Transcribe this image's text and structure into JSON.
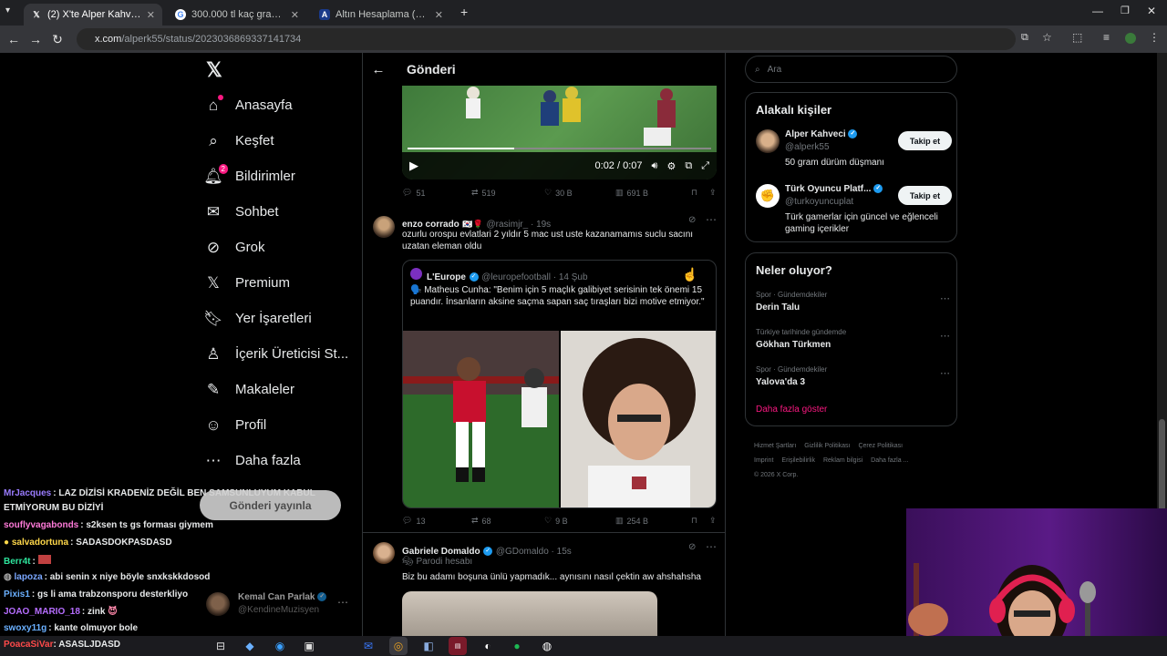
{
  "browser": {
    "tabs": [
      {
        "title": "(2) X'te Alper Kahveci: \"TL İLE N",
        "icon": "x-logo-icon"
      },
      {
        "title": "300.000 tl kaç gram altın - Goo",
        "icon": "google-icon"
      },
      {
        "title": "Altın Hesaplama (Çeyrek ve Gra",
        "icon": "site-icon"
      }
    ],
    "url_host": "x.com",
    "url_path": "/alperk55/status/2023036869337141734"
  },
  "nav": {
    "items": [
      {
        "label": "Anasayfa",
        "icon": "home-icon"
      },
      {
        "label": "Keşfet",
        "icon": "search-icon"
      },
      {
        "label": "Bildirimler",
        "icon": "bell-icon",
        "badge": "2"
      },
      {
        "label": "Sohbet",
        "icon": "mail-icon"
      },
      {
        "label": "Grok",
        "icon": "grok-icon"
      },
      {
        "label": "Premium",
        "icon": "x-icon"
      },
      {
        "label": "Yer İşaretleri",
        "icon": "bookmark-icon"
      },
      {
        "label": "İçerik Üreticisi St...",
        "icon": "creator-icon"
      },
      {
        "label": "Makaleler",
        "icon": "article-icon"
      },
      {
        "label": "Profil",
        "icon": "person-icon"
      },
      {
        "label": "Daha fazla",
        "icon": "more-icon"
      }
    ],
    "post_button": "Gönderi yayınla"
  },
  "main": {
    "header": "Gönderi",
    "video": {
      "time": "0:02 / 0:07"
    },
    "post_stats": {
      "replies": "51",
      "reposts": "519",
      "likes": "30 B",
      "views": "691 B"
    },
    "reply1": {
      "name": "enzo corrado",
      "handle": "@rasimjr_ · 19s",
      "text": "ozurlu orospu evlatlari 2 yıldır 5 mac ust uste kazanamamıs suclu sacını uzatan eleman oldu",
      "quote": {
        "name": "L'Europe",
        "handle": "@leuropefootball · 14 Şub",
        "text": "🗣️ Matheus Cunha: \"Benim için 5 maçlık galibiyet serisinin tek önemi 15 puandır. İnsanların aksine saçma sapan saç tıraşları bizi motive etmiyor.\""
      },
      "stats": {
        "replies": "13",
        "reposts": "68",
        "likes": "9 B",
        "views": "254 B"
      }
    },
    "reply2": {
      "name": "Gabriele Domaldo",
      "handle": "@GDomaldo · 15s",
      "label": "Parodi hesabı",
      "text": "Biz bu adamı boşuna ünlü yapmadık... aynısını nasıl çektin aw ahshahsha"
    }
  },
  "right": {
    "search_placeholder": "Ara",
    "related": {
      "title": "Alakalı kişiler",
      "people": [
        {
          "name": "Alper Kahveci",
          "handle": "@alperk55",
          "bio": "50 gram dürüm düşmanı",
          "follow": "Takip et"
        },
        {
          "name": "Türk Oyuncu Platf...",
          "handle": "@turkoyuncuplat",
          "bio": "Türk gamerlar için güncel ve eğlenceli gaming içerikler",
          "follow": "Takip et"
        }
      ]
    },
    "trends": {
      "title": "Neler oluyor?",
      "items": [
        {
          "category": "Spor · Gündemdekiler",
          "topic": "Derin Talu"
        },
        {
          "category": "Türkiye tarihinde gündemde",
          "topic": "Gökhan Türkmen"
        },
        {
          "category": "Spor · Gündemdekiler",
          "topic": "Yalova'da 3"
        }
      ],
      "more": "Daha fazla göster"
    },
    "footer": [
      "Hizmet Şartları",
      "Gizlilik Politikası",
      "Çerez Politikası",
      "Imprint",
      "Erişilebilirlik",
      "Reklam bilgisi",
      "Daha fazla ...",
      "© 2026 X Corp."
    ]
  },
  "chat": [
    {
      "user": "MrJacques",
      "color": "#9a7cff",
      "msg": "LAZ DİZİSİ KRADENİZ DEĞİL BEN SAMSUNLUYUM KABUL"
    },
    {
      "user": "",
      "color": "#fff",
      "msg": "ETMİYORUM BU DİZİYİ"
    },
    {
      "user": "souflyvagabonds",
      "color": "#ff7ad9",
      "msg": "s2ksen ts gs forması giymem"
    },
    {
      "user": "salvadortuna",
      "color": "#ffd84a",
      "msg": "SADASDOKPASDASD"
    },
    {
      "user": "Berr4t",
      "color": "#2ee59d",
      "msg": ""
    },
    {
      "user": "lapoza",
      "color": "#7aa7ff",
      "msg": "abi senin x niye böyle snxkskkdosod"
    },
    {
      "user": "Pixis1",
      "color": "#6ab0ff",
      "msg": "gs li ama trabzonsporu desterkliyo"
    },
    {
      "user": "JOAO_MARIO_18",
      "color": "#b66dff",
      "msg": "zink"
    },
    {
      "user": "swoxy11g",
      "color": "#6ab0ff",
      "msg": "kante olmuyor bole"
    },
    {
      "user": "PoacaSiVar",
      "color": "#ff4a4a",
      "msg": "ASASLJDASD"
    }
  ],
  "ghost_user": {
    "name": "Kemal Can Parlak",
    "handle": "@KendineMuzisyen"
  }
}
